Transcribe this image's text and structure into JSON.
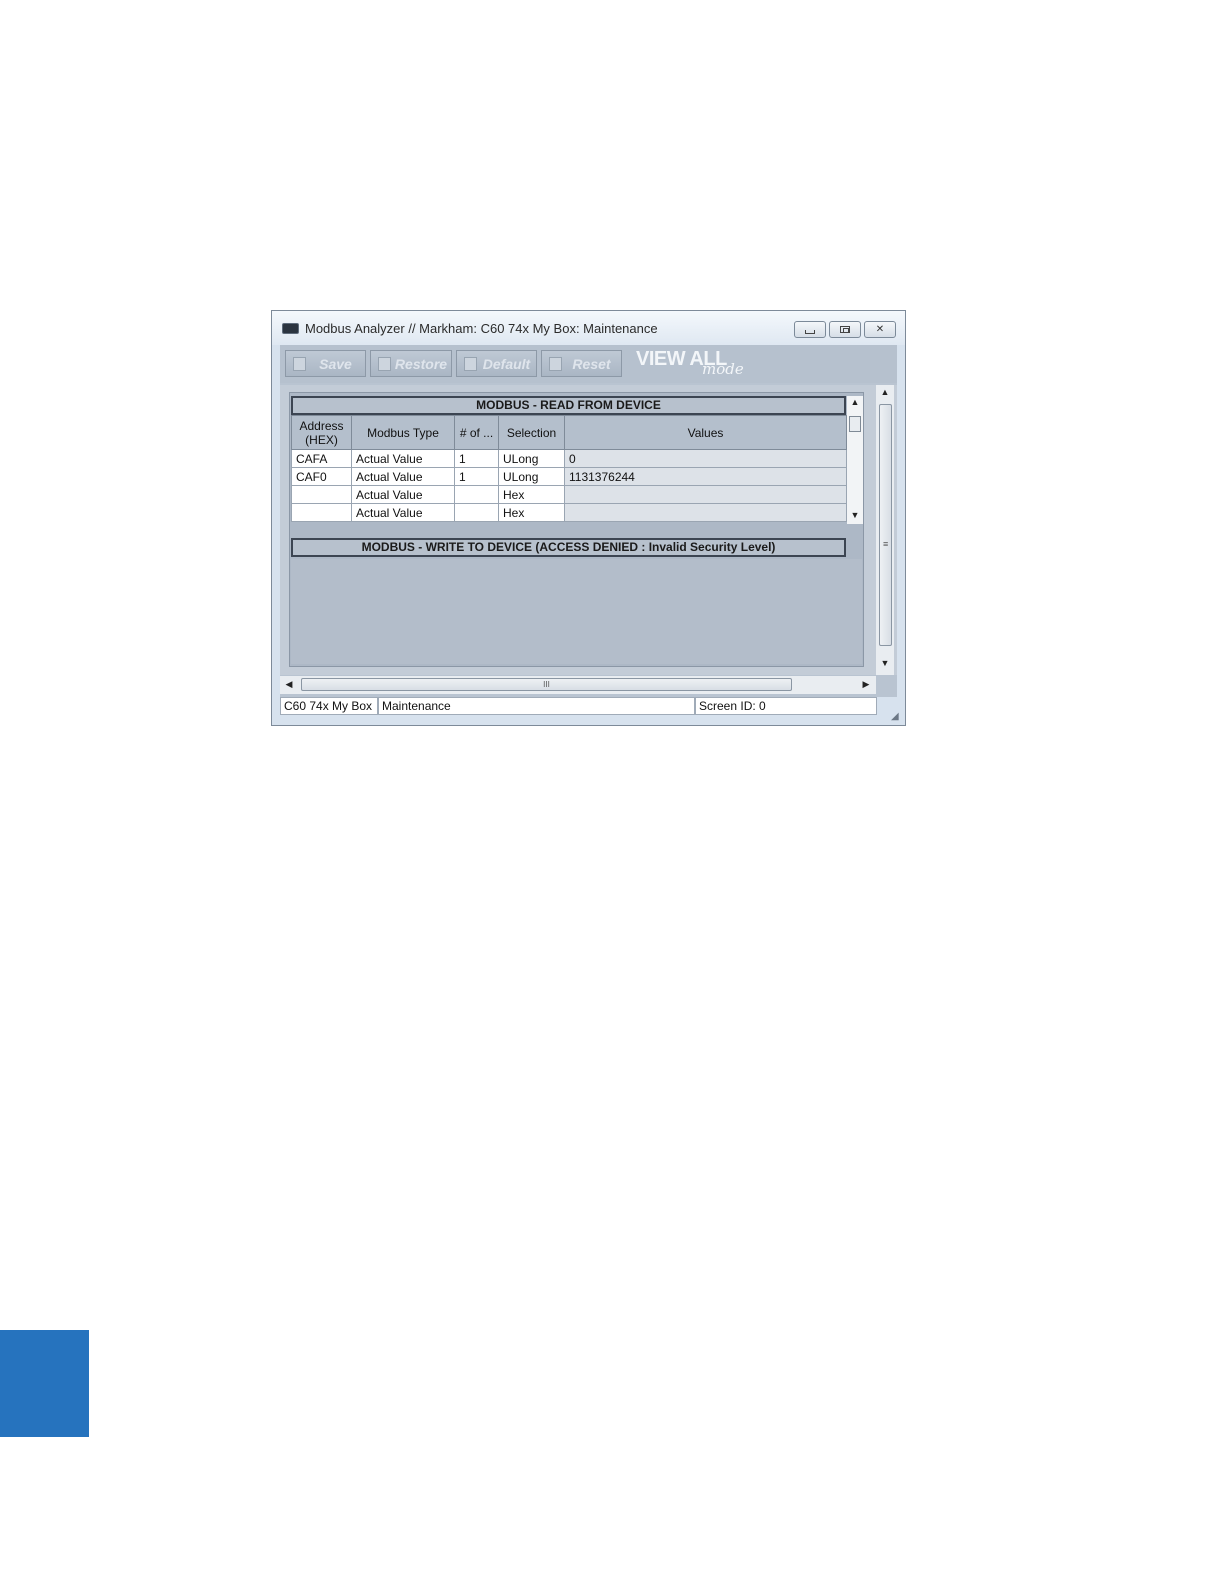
{
  "window": {
    "title": "Modbus Analyzer // Markham: C60 74x My Box: Maintenance",
    "controls": {
      "minimize": "minimize",
      "maximize": "maximize",
      "close": "✕"
    }
  },
  "toolbar": {
    "save_label": "Save",
    "restore_label": "Restore",
    "default_label": "Default",
    "reset_label": "Reset",
    "view_all": "VIEW ALL",
    "mode": "mode"
  },
  "read_section": {
    "title": "MODBUS - READ FROM DEVICE",
    "columns": [
      "Address (HEX)",
      "Modbus Type",
      "# of ...",
      "Selection",
      "Values"
    ],
    "rows": [
      {
        "address": "CAFA",
        "type": "Actual Value",
        "count": "1",
        "selection": "ULong",
        "value": "0"
      },
      {
        "address": "CAF0",
        "type": "Actual Value",
        "count": "1",
        "selection": "ULong",
        "value": "1131376244"
      },
      {
        "address": "",
        "type": "Actual Value",
        "count": "",
        "selection": "Hex",
        "value": ""
      },
      {
        "address": "",
        "type": "Actual Value",
        "count": "",
        "selection": "Hex",
        "value": ""
      }
    ]
  },
  "write_section": {
    "title": "MODBUS - WRITE TO DEVICE  (ACCESS DENIED : Invalid Security Level)"
  },
  "scroll": {
    "up": "▲",
    "down": "▼",
    "left": "◀",
    "right": "▶",
    "grip_v": "≡",
    "grip_h": "III"
  },
  "statusbar": {
    "device": "C60 74x My Box",
    "mode": "Maintenance",
    "screen_id": "Screen ID: 0"
  },
  "colors": {
    "side_tab": "#2673be",
    "frame": "#d7e2ee",
    "panel": "#b9c4d1"
  }
}
